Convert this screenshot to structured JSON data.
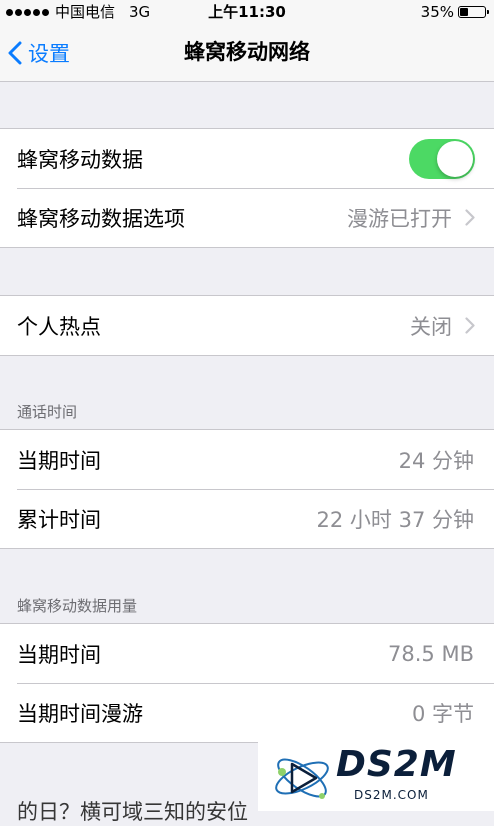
{
  "status_bar": {
    "carrier": "中国电信",
    "network": "3G",
    "time": "上午11:30",
    "battery_percent": "35%",
    "battery_level": 0.35
  },
  "nav": {
    "back_label": "设置",
    "title": "蜂窝移动网络"
  },
  "group1": {
    "cellular_data_label": "蜂窝移动数据",
    "cellular_data_on": true,
    "options_label": "蜂窝移动数据选项",
    "options_value": "漫游已打开"
  },
  "group2": {
    "hotspot_label": "个人热点",
    "hotspot_value": "关闭"
  },
  "call_time": {
    "header": "通话时间",
    "current_label": "当期时间",
    "current_value": "24 分钟",
    "lifetime_label": "累计时间",
    "lifetime_value": "22 小时 37 分钟"
  },
  "data_usage": {
    "header": "蜂窝移动数据用量",
    "current_label": "当期时间",
    "current_value": "78.5 MB",
    "roaming_label": "当期时间漫游",
    "roaming_value": "0 字节"
  },
  "bottom_partial": "的日？横可域三知的安位",
  "watermark": {
    "text": "DS2M",
    "sub": "DS2M.COM"
  },
  "colors": {
    "accent": "#0a7cff",
    "toggle_on": "#4cd964",
    "secondary_text": "#8e8e93",
    "background": "#efeff4"
  }
}
